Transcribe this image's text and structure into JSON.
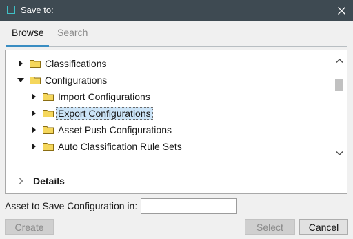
{
  "window": {
    "title": "Save to:",
    "close_icon": "close-icon"
  },
  "tabs": [
    {
      "label": "Browse",
      "active": true
    },
    {
      "label": "Search",
      "active": false
    }
  ],
  "tree": [
    {
      "label": "Classifications",
      "level": 0,
      "expanded": false,
      "selected": false
    },
    {
      "label": "Configurations",
      "level": 0,
      "expanded": true,
      "selected": false
    },
    {
      "label": "Import Configurations",
      "level": 1,
      "expanded": false,
      "selected": false
    },
    {
      "label": "Export Configurations",
      "level": 1,
      "expanded": false,
      "selected": true
    },
    {
      "label": "Asset Push Configurations",
      "level": 1,
      "expanded": false,
      "selected": false
    },
    {
      "label": "Auto Classification Rule Sets",
      "level": 1,
      "expanded": false,
      "selected": false
    }
  ],
  "details": {
    "label": "Details",
    "expanded": false
  },
  "asset_field": {
    "label": "Asset to Save Configuration in:",
    "value": "",
    "placeholder": ""
  },
  "buttons": {
    "create": {
      "label": "Create",
      "enabled": false
    },
    "select": {
      "label": "Select",
      "enabled": false
    },
    "cancel": {
      "label": "Cancel",
      "enabled": true
    }
  },
  "colors": {
    "titlebar": "#3e4a52",
    "accent": "#3a8dc2",
    "folder": "#f5d75c",
    "selection": "#cce4f7"
  }
}
